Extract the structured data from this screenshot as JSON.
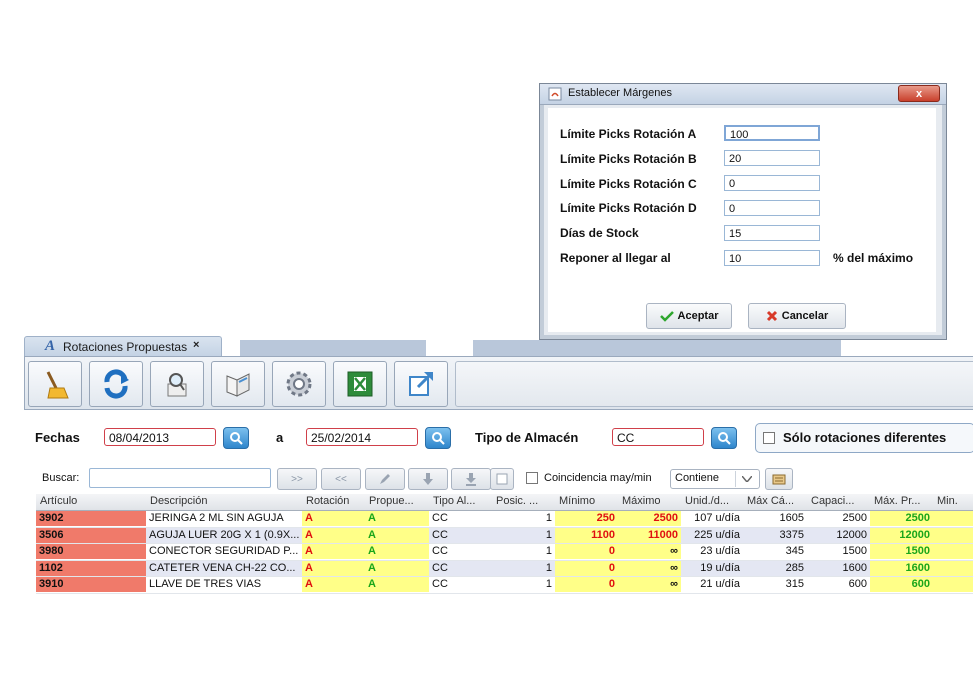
{
  "tab": {
    "icon_letter": "A",
    "label": "Rotaciones Propuestas",
    "close": "×"
  },
  "toolbar": {
    "buttons": [
      {
        "icon": "broom-icon"
      },
      {
        "icon": "refresh-icon"
      },
      {
        "icon": "preview-icon"
      },
      {
        "icon": "book-icon"
      },
      {
        "icon": "settings-gear-icon"
      },
      {
        "icon": "excel-icon"
      },
      {
        "icon": "export-icon"
      }
    ]
  },
  "filters": {
    "fechas_label": "Fechas",
    "fecha_desde": "08/04/2013",
    "a_label": "a",
    "fecha_hasta": "25/02/2014",
    "tipo_label": "Tipo de Almacén",
    "tipo_value": "CC",
    "solo_label": "Sólo rotaciones diferentes"
  },
  "searchbar": {
    "label": "Buscar:",
    "value": "",
    "next": ">>",
    "prev": "<<",
    "case_label": "Coincidencia may/min",
    "mode": "Contiene"
  },
  "table": {
    "columns": [
      "Artículo",
      "Descripción",
      "Rotación",
      "Propue...",
      "Tipo Al...",
      "Posic. ...",
      "Mínimo",
      "Máximo",
      "Unid./d...",
      "Máx Cá...",
      "Capaci...",
      "Máx. Pr...",
      "Min."
    ],
    "rows": [
      {
        "art": "3902",
        "desc": "JERINGA 2 ML SIN AGUJA",
        "rot": "A",
        "prop": "A",
        "tipo": "CC",
        "pos": "1",
        "min": "250",
        "max": "2500",
        "unid": "107 u/día",
        "maxca": "1605",
        "cap": "2500",
        "maxpr": "2500"
      },
      {
        "art": "3506",
        "desc": "AGUJA LUER 20G X 1 (0.9X...",
        "rot": "A",
        "prop": "A",
        "tipo": "CC",
        "pos": "1",
        "min": "1100",
        "max": "11000",
        "unid": "225 u/día",
        "maxca": "3375",
        "cap": "12000",
        "maxpr": "12000"
      },
      {
        "art": "3980",
        "desc": "CONECTOR SEGURIDAD P...",
        "rot": "A",
        "prop": "A",
        "tipo": "CC",
        "pos": "1",
        "min": "0",
        "max": "∞",
        "unid": "23 u/día",
        "maxca": "345",
        "cap": "1500",
        "maxpr": "1500"
      },
      {
        "art": "1102",
        "desc": "CATETER VENA CH-22 CO...",
        "rot": "A",
        "prop": "A",
        "tipo": "CC",
        "pos": "1",
        "min": "0",
        "max": "∞",
        "unid": "19 u/día",
        "maxca": "285",
        "cap": "1600",
        "maxpr": "1600"
      },
      {
        "art": "3910",
        "desc": "LLAVE DE TRES VIAS",
        "rot": "A",
        "prop": "A",
        "tipo": "CC",
        "pos": "1",
        "min": "0",
        "max": "∞",
        "unid": "21 u/día",
        "maxca": "315",
        "cap": "600",
        "maxpr": "600"
      }
    ]
  },
  "dialog": {
    "title": "Establecer Márgenes",
    "close": "x",
    "fields": [
      {
        "label": "Límite Picks Rotación A",
        "value": "100"
      },
      {
        "label": "Límite Picks Rotación B",
        "value": "20"
      },
      {
        "label": "Límite Picks Rotación C",
        "value": "0"
      },
      {
        "label": "Límite Picks Rotación D",
        "value": "0"
      },
      {
        "label": "Días de Stock",
        "value": "15"
      },
      {
        "label": "Reponer al llegar al",
        "value": "10"
      }
    ],
    "suffix": "% del máximo",
    "accept": "Aceptar",
    "cancel": "Cancelar"
  }
}
